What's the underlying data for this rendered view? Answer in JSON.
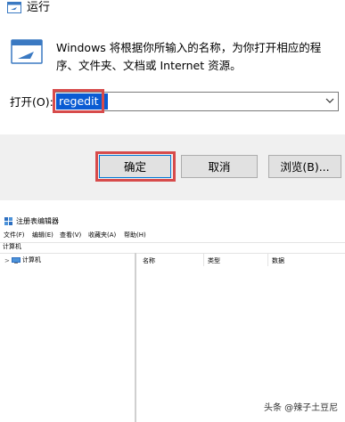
{
  "run_dialog": {
    "title": "运行",
    "description": "Windows 将根据你所输入的名称，为你打开相应的程序、文件夹、文档或 Internet 资源。",
    "open_label": "打开(O):",
    "open_value": "regedit",
    "ok_label": "确定",
    "cancel_label": "取消",
    "browse_label": "浏览(B)...",
    "icon": "run-icon",
    "highlight_color": "#d74b4b",
    "selection_color": "#0a5bd3"
  },
  "regedit": {
    "title": "注册表编辑器",
    "menu": [
      "文件(F)",
      "编辑(E)",
      "查看(V)",
      "收藏夹(A)",
      "帮助(H)"
    ],
    "address": "计算机",
    "tree_root": "计算机",
    "columns": [
      "名称",
      "类型",
      "数据"
    ]
  },
  "watermark": "头条 @辣子土豆尼"
}
